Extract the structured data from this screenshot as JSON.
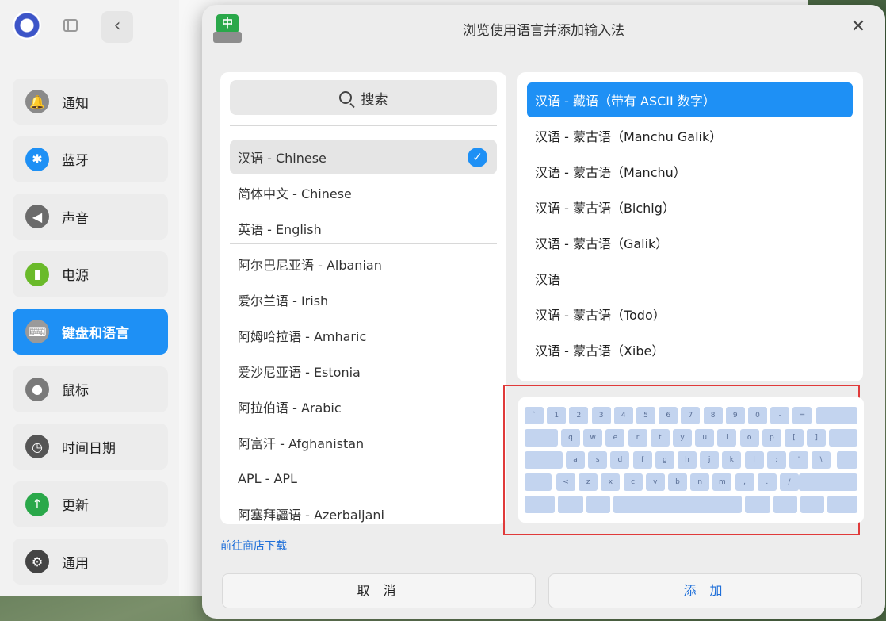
{
  "sidebar": {
    "items": [
      {
        "label": "通知",
        "icon": "bell-icon",
        "color": "#8a8a8a"
      },
      {
        "label": "蓝牙",
        "icon": "bluetooth-icon",
        "color": "#1e90f5"
      },
      {
        "label": "声音",
        "icon": "speaker-icon",
        "color": "#6b6b6b"
      },
      {
        "label": "电源",
        "icon": "battery-icon",
        "color": "#6aba2a"
      },
      {
        "label": "键盘和语言",
        "icon": "keyboard-icon",
        "color": "#9a9a9a",
        "active": true
      },
      {
        "label": "鼠标",
        "icon": "mouse-icon",
        "color": "#7a7a7a"
      },
      {
        "label": "时间日期",
        "icon": "clock-icon",
        "color": "#555555"
      },
      {
        "label": "更新",
        "icon": "update-icon",
        "color": "#2aa84a"
      },
      {
        "label": "通用",
        "icon": "gear-icon",
        "color": "#444444"
      }
    ]
  },
  "dialog": {
    "title": "浏览使用语言并添加输入法",
    "icon_glyph": "中",
    "search_placeholder": "搜索",
    "languages": [
      {
        "label": "汉语 - Chinese",
        "selected": true
      },
      {
        "label": "简体中文 - Chinese"
      },
      {
        "label": "英语 - English"
      },
      {
        "label": "阿尔巴尼亚语 - Albanian"
      },
      {
        "label": "爱尔兰语 - Irish"
      },
      {
        "label": "阿姆哈拉语 - Amharic"
      },
      {
        "label": "爱沙尼亚语 - Estonia"
      },
      {
        "label": "阿拉伯语 - Arabic"
      },
      {
        "label": "阿富汗 - Afghanistan"
      },
      {
        "label": "APL - APL"
      },
      {
        "label": "阿塞拜疆语 - Azerbaijani"
      }
    ],
    "input_methods": [
      {
        "label": "汉语 - 藏语（带有 ASCII 数字）",
        "selected": true
      },
      {
        "label": "汉语 - 蒙古语（Manchu Galik）"
      },
      {
        "label": "汉语 - 蒙古语（Manchu）"
      },
      {
        "label": "汉语 - 蒙古语（Bichig）"
      },
      {
        "label": "汉语 - 蒙古语（Galik）"
      },
      {
        "label": "汉语"
      },
      {
        "label": "汉语 - 蒙古语（Todo）"
      },
      {
        "label": "汉语 - 蒙古语（Xibe）"
      }
    ],
    "keyboard_rows": [
      [
        "`",
        "1",
        "2",
        "3",
        "4",
        "5",
        "6",
        "7",
        "8",
        "9",
        "0",
        "-",
        "="
      ],
      [
        "q",
        "w",
        "e",
        "r",
        "t",
        "y",
        "u",
        "i",
        "o",
        "p",
        "[",
        "]"
      ],
      [
        "a",
        "s",
        "d",
        "f",
        "g",
        "h",
        "j",
        "k",
        "l",
        ";",
        "'",
        "\\"
      ],
      [
        "<",
        "z",
        "x",
        "c",
        "v",
        "b",
        "n",
        "m",
        ",",
        ".",
        "/"
      ]
    ],
    "store_link": "前往商店下载",
    "cancel_label": "取 消",
    "add_label": "添 加"
  },
  "colors": {
    "accent": "#1e90f5",
    "highlight_border": "#e03a3a",
    "link": "#1e6fd9"
  }
}
